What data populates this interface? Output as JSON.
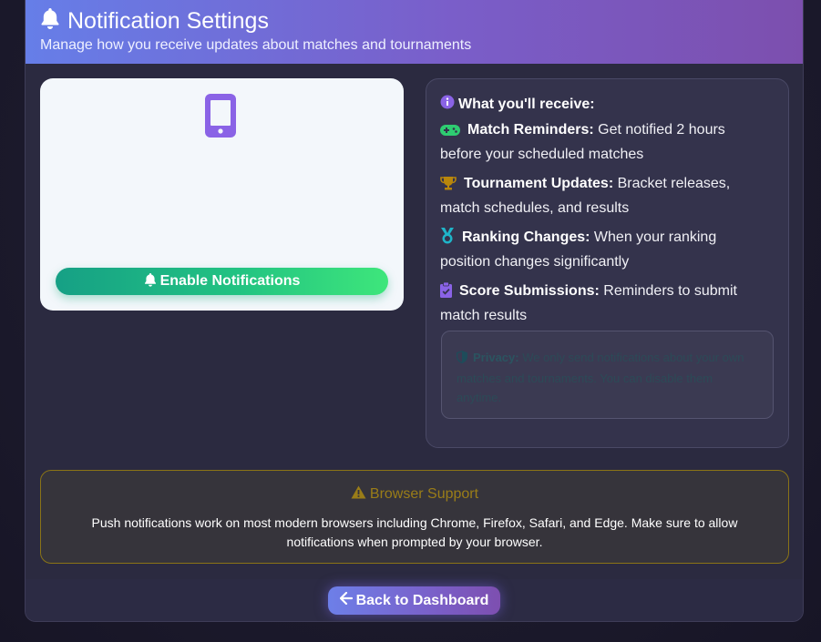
{
  "header": {
    "title": "Notification Settings",
    "subtitle": "Manage how you receive updates about matches and tournaments",
    "icon": "bell-icon"
  },
  "enable_card": {
    "icon": "mobile-phone-icon",
    "button_label": "Enable Notifications",
    "button_icon": "bell-icon"
  },
  "receive": {
    "title": "What you'll receive:",
    "title_icon": "info-circle-icon",
    "items": [
      {
        "icon": "gamepad-icon",
        "label": "Match Reminders:",
        "text": "Get notified 2 hours before your scheduled matches"
      },
      {
        "icon": "trophy-icon",
        "label": "Tournament Updates:",
        "text": "Bracket releases, match schedules, and results"
      },
      {
        "icon": "medal-icon",
        "label": "Ranking Changes:",
        "text": "When your ranking position changes significantly"
      },
      {
        "icon": "clipboard-check-icon",
        "label": "Score Submissions:",
        "text": "Reminders to submit match results"
      }
    ],
    "privacy": {
      "icon": "shield-icon",
      "label": "Privacy:",
      "text": "We only send notifications about your own matches and tournaments. You can disable them anytime."
    }
  },
  "browser_support": {
    "icon": "warning-icon",
    "title": "Browser Support",
    "text": "Push notifications work on most modern browsers including Chrome, Firefox, Safari, and Edge. Make sure to allow notifications when prompted by your browser."
  },
  "footer": {
    "back_label": "Back to Dashboard",
    "back_icon": "arrow-left-icon"
  },
  "colors": {
    "accent": "#7c6ee6",
    "success": "#2ecc71",
    "warning": "#9a7d18"
  }
}
